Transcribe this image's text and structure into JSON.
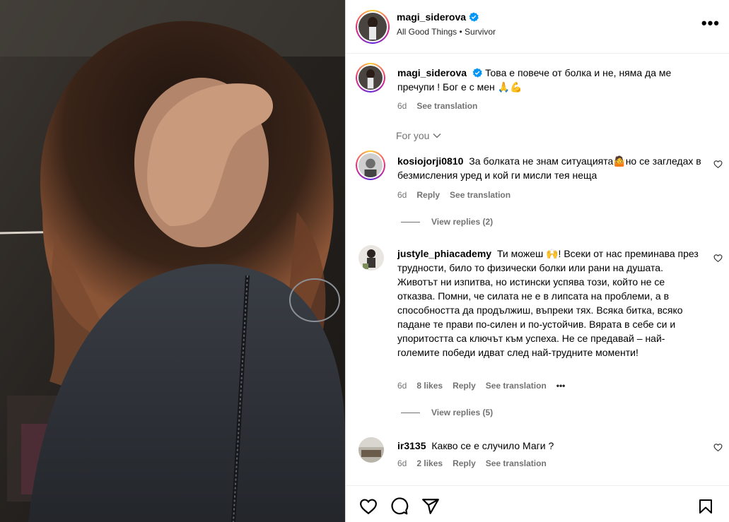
{
  "post": {
    "author": "magi_siderova",
    "subtitle": "All Good Things • Survivor",
    "caption": "Това е повече от болка и не, няма да ме пречупи ! Бог е с мен 🙏💪",
    "caption_time": "6d",
    "see_translation": "See translation",
    "more_icon": "more-dots-icon"
  },
  "comments_section": {
    "for_you": "For you"
  },
  "comments": [
    {
      "user": "kosiojorji0810",
      "text": "За болката не знам ситуацията🤷но се загледах в безмисления уред и кой ги мисли тея неща",
      "time": "6d",
      "reply": "Reply",
      "translate": "See translation",
      "view_replies": "View replies (2)"
    },
    {
      "user": "justyle_phiacademy",
      "text": "Ти можеш 🙌! Всеки от нас преминава през трудности, било то физически болки или рани на душата. Животът ни изпитва, но истински успява този, който не се отказва. Помни, че силата не е в липсата на проблеми, а в способността да продължиш, въпреки тях. Всяка битка, всяко падане те прави по-силен и по-устойчив. Вярата в себе си и упоритостта са ключът към успеха. Не се предавай – най-големите победи идват след най-трудните моменти!",
      "time": "6d",
      "likes": "8 likes",
      "reply": "Reply",
      "translate": "See translation",
      "more": "•••",
      "view_replies": "View replies (5)"
    },
    {
      "user": "ir3135",
      "text": "Какво се е случило Маги ?",
      "time": "6d",
      "likes": "2 likes",
      "reply": "Reply",
      "translate": "See translation"
    }
  ],
  "actions": {
    "icons": [
      "heart-icon",
      "comment-icon",
      "share-icon",
      "bookmark-icon"
    ]
  },
  "colors": {
    "verified": "#0095f6",
    "secondary_text": "#737373",
    "border": "#dbdbdb"
  }
}
